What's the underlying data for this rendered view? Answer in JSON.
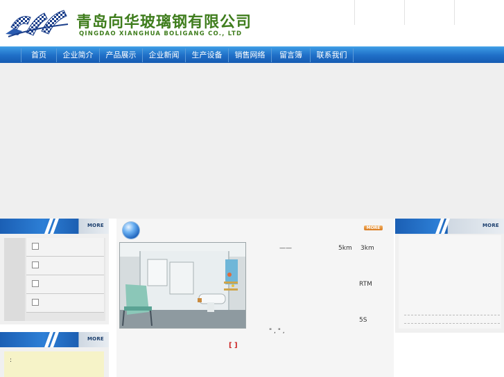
{
  "header": {
    "company_cn": "青岛向华玻璃钢有限公司",
    "company_en": "QINGDAO XIANGHUA BOLIGANG CO., LTD",
    "logo_icon": "xhf-checkered-logo-icon",
    "brand_color": "#3f7d1d"
  },
  "nav": {
    "items": [
      {
        "label": "首页"
      },
      {
        "label": "企业简介"
      },
      {
        "label": "产品展示"
      },
      {
        "label": "企业新闻"
      },
      {
        "label": "生产设备"
      },
      {
        "label": "销售网络"
      },
      {
        "label": "留言簿"
      },
      {
        "label": "联系我们"
      }
    ],
    "color": "#1f6fc7"
  },
  "left_panel": {
    "more_label": "MORE",
    "checkbox_count": 4
  },
  "left_panel2": {
    "more_label": "MORE",
    "text": ":"
  },
  "center": {
    "more_label": "MORE",
    "dash": "——",
    "text_5km": "5km",
    "text_3km": "3km",
    "text_rtm": "RTM",
    "text_5s": "5S",
    "quote_line": "\"          ,      \"  ,",
    "bracket": "[  ]",
    "photo_icon": "bathroom-photo"
  },
  "right_panel": {
    "more_label": "MORE"
  }
}
